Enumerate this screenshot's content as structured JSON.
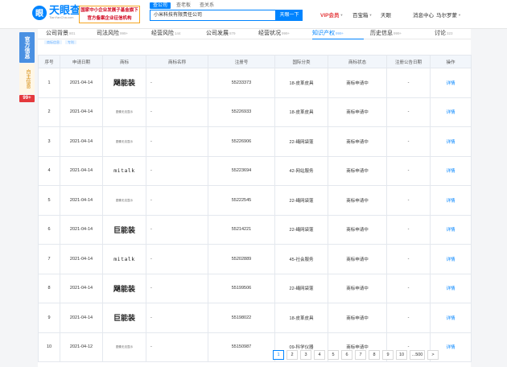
{
  "header": {
    "logo_name": "天眼查",
    "logo_sub": "TianYanCha.com",
    "promo_line1": "国家中小企业发展子基金旗下",
    "promo_line2": "官方备案企业征信机构",
    "search_tabs": [
      "查公司",
      "查老板",
      "查关系"
    ],
    "search_value": "小米科技有限责任公司",
    "search_button": "天眼一下",
    "nav": {
      "vip": "VIP会员",
      "app": "百宝箱",
      "tianyan": "天眼",
      "msg": "消息中心",
      "user": "马尔罗蒙"
    }
  },
  "sidebar": {
    "official": "官方信息",
    "self": "自主信息",
    "badge": "99+"
  },
  "tabs": [
    {
      "label": "公司背景",
      "count": "801"
    },
    {
      "label": "司法风险",
      "count": "999+"
    },
    {
      "label": "经营风险",
      "count": "144"
    },
    {
      "label": "公司发展",
      "count": "879"
    },
    {
      "label": "经营状况",
      "count": "999+"
    },
    {
      "label": "知识产权",
      "count": "999+"
    },
    {
      "label": "历史信息",
      "count": "999+"
    },
    {
      "label": "讨论",
      "count": "323"
    }
  ],
  "subtabs": [
    "商标信息",
    "专利"
  ],
  "table": {
    "headers": [
      "序号",
      "申请日期",
      "商标",
      "商标名称",
      "注册号",
      "国际分类",
      "商标状态",
      "注册公告日期",
      "操作"
    ],
    "rows": [
      {
        "no": "1",
        "date": "2021-04-14",
        "mark": "飓能装",
        "mark_style": "bold",
        "name": "-",
        "reg": "55233373",
        "class": "18-皮革皮具",
        "status": "商标申请中",
        "pub": "-",
        "op": "详情"
      },
      {
        "no": "2",
        "date": "2021-04-14",
        "mark": "图像无法显示",
        "mark_style": "img",
        "name": "-",
        "reg": "55226933",
        "class": "18-皮革皮具",
        "status": "商标申请中",
        "pub": "-",
        "op": "详情"
      },
      {
        "no": "3",
        "date": "2021-04-14",
        "mark": "图像无法显示",
        "mark_style": "img",
        "name": "-",
        "reg": "55226906",
        "class": "22-绳网袋蓬",
        "status": "商标申请中",
        "pub": "-",
        "op": "详情"
      },
      {
        "no": "4",
        "date": "2021-04-14",
        "mark": "mitalk",
        "mark_style": "mono",
        "name": "-",
        "reg": "55223694",
        "class": "42-网站服务",
        "status": "商标申请中",
        "pub": "-",
        "op": "详情"
      },
      {
        "no": "5",
        "date": "2021-04-14",
        "mark": "图像无法显示",
        "mark_style": "img",
        "name": "-",
        "reg": "55222545",
        "class": "22-绳网袋蓬",
        "status": "商标申请中",
        "pub": "-",
        "op": "详情"
      },
      {
        "no": "6",
        "date": "2021-04-14",
        "mark": "巨能装",
        "mark_style": "bold",
        "name": "-",
        "reg": "55214221",
        "class": "22-绳网袋蓬",
        "status": "商标申请中",
        "pub": "-",
        "op": "详情"
      },
      {
        "no": "7",
        "date": "2021-04-14",
        "mark": "mitalk",
        "mark_style": "mono",
        "name": "-",
        "reg": "55202889",
        "class": "45-社会服务",
        "status": "商标申请中",
        "pub": "-",
        "op": "详情"
      },
      {
        "no": "8",
        "date": "2021-04-14",
        "mark": "飓能装",
        "mark_style": "bold",
        "name": "-",
        "reg": "55199506",
        "class": "22-绳网袋蓬",
        "status": "商标申请中",
        "pub": "-",
        "op": "详情"
      },
      {
        "no": "9",
        "date": "2021-04-14",
        "mark": "巨能装",
        "mark_style": "bold",
        "name": "-",
        "reg": "55198022",
        "class": "18-皮革皮具",
        "status": "商标申请中",
        "pub": "-",
        "op": "详情"
      },
      {
        "no": "10",
        "date": "2021-04-12",
        "mark": "图像无法显示",
        "mark_style": "img",
        "name": "-",
        "reg": "55150987",
        "class": "09-科学仪器",
        "status": "商标申请中",
        "pub": "-",
        "op": "详情"
      }
    ]
  },
  "pager": [
    "1",
    "2",
    "3",
    "4",
    "5",
    "6",
    "7",
    "8",
    "9",
    "10",
    "...500",
    ">"
  ],
  "pager_active": "1"
}
